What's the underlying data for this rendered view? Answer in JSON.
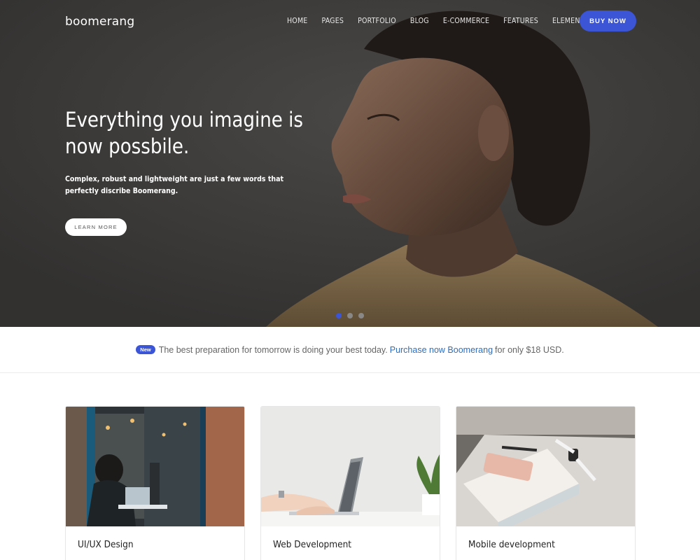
{
  "brand": {
    "logo_text": "boomerang",
    "accent_color": "#3b55d6"
  },
  "nav": {
    "items": [
      "HOME",
      "PAGES",
      "PORTFOLIO",
      "BLOG",
      "E-COMMERCE",
      "FEATURES",
      "ELEMENTS"
    ],
    "buy_label": "BUY NOW"
  },
  "hero": {
    "title": "Everything you imagine is now possbile.",
    "subtitle": "Complex, robust and lightweight are just a few words that perfectly discribe Boomerang.",
    "cta_label": "LEARN MORE",
    "slides_total": 3,
    "active_slide": 1
  },
  "promo": {
    "badge": "New",
    "text_before": "The best preparation for tomorrow is doing your best today.",
    "link_text": "Purchase now Boomerang",
    "text_after": "for only $18 USD.",
    "link_color": "#2f6dbd"
  },
  "cards": [
    {
      "title": "UI/UX Design",
      "image_icon": "cafe-laptop-photo"
    },
    {
      "title": "Web Development",
      "image_icon": "laptop-desk-photo"
    },
    {
      "title": "Mobile development",
      "image_icon": "phone-desk-photo"
    }
  ]
}
